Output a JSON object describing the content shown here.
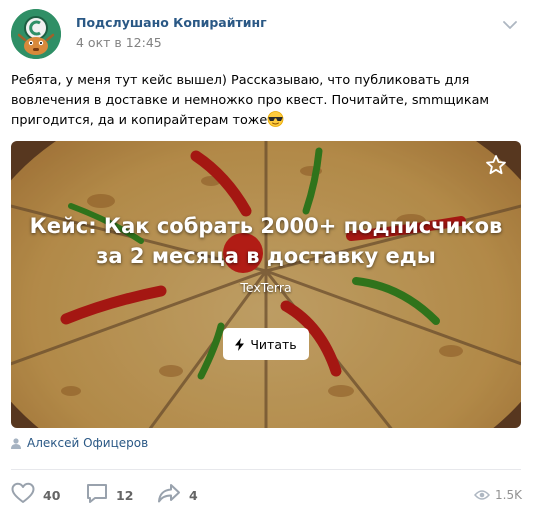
{
  "group": {
    "name": "Подслушано Копирайтинг",
    "date": "4 окт в 12:45"
  },
  "post": {
    "text_before_highlight": "Ребята, у меня тут ",
    "highlight_word": "кейс",
    "text_after_highlight": " вышел) Рассказываю, что публиковать для вовлечения в доставке и немножко про квест. Почитайте, smmщикам пригодится, да и копирайтерам тоже",
    "emoji": "sunglasses-emoji"
  },
  "card": {
    "title": "Кейс: Как собрать 2000+ подписчиков за 2 месяца в доставку еды",
    "source": "TexTerra",
    "read_label": "Читать",
    "read_icon": "lightning-icon",
    "bookmark_icon": "star-icon"
  },
  "author": {
    "name": "Алексей Офицеров",
    "icon": "person-icon"
  },
  "actions": {
    "likes": "40",
    "comments": "12",
    "shares": "4",
    "views": "1.5K"
  },
  "colors": {
    "link": "#2a5885",
    "meta": "#828282",
    "action_icon": "#99a2ad"
  }
}
